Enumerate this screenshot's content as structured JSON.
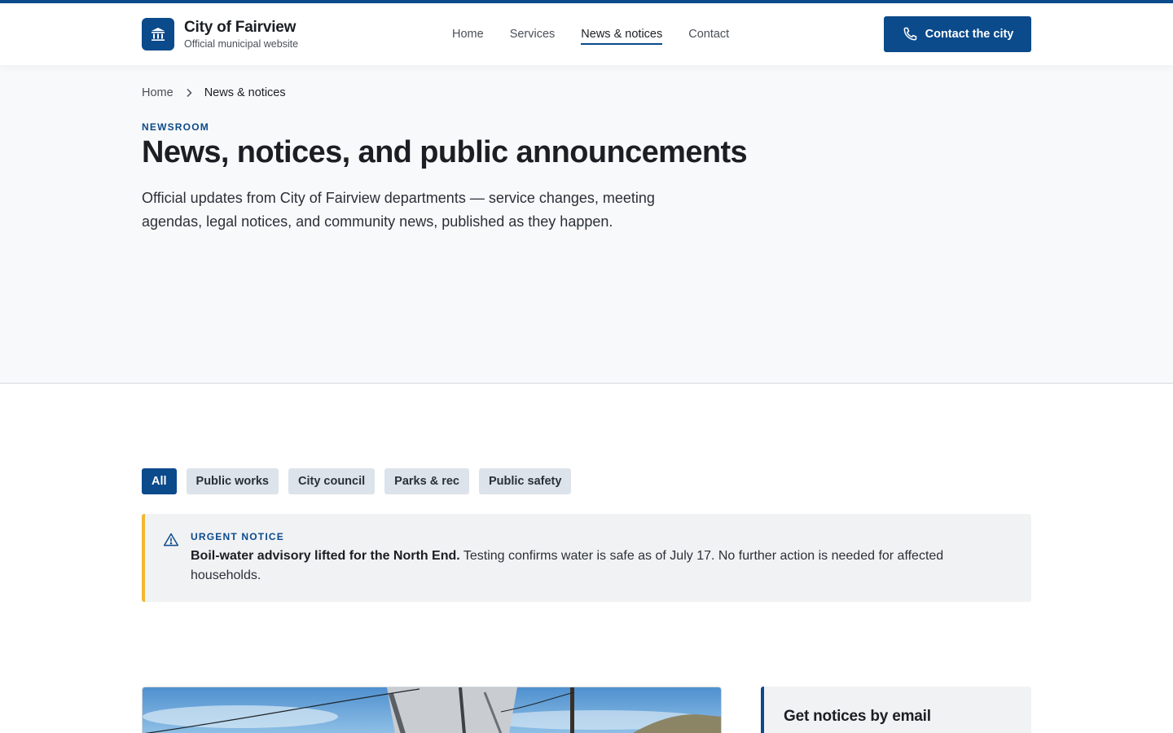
{
  "header": {
    "brand_name": "City of Fairview",
    "brand_tagline": "Official municipal website",
    "brand_icon": "city-hall-icon",
    "nav": [
      {
        "label": "Home",
        "active": false
      },
      {
        "label": "Services",
        "active": false
      },
      {
        "label": "News & notices",
        "active": true
      },
      {
        "label": "Contact",
        "active": false
      }
    ],
    "cta_label": "Contact the city",
    "cta_icon": "phone-icon"
  },
  "hero": {
    "breadcrumb": {
      "home": "Home",
      "current": "News & notices"
    },
    "eyebrow": "NEWSROOM",
    "title": "News, notices, and public announcements",
    "lede": "Official updates from City of Fairview departments — service changes, meeting agendas, legal notices, and community news, published as they happen."
  },
  "filters": {
    "chips": [
      {
        "label": "All",
        "active": true
      },
      {
        "label": "Public works",
        "active": false
      },
      {
        "label": "City council",
        "active": false
      },
      {
        "label": "Parks & rec",
        "active": false
      },
      {
        "label": "Public safety",
        "active": false
      }
    ]
  },
  "alert": {
    "label": "URGENT NOTICE",
    "headline": "Boil-water advisory lifted for the North End.",
    "body": "Testing confirms water is safe as of July 17. No further action is needed for affected households.",
    "icon": "warning-triangle-icon"
  },
  "subscribe": {
    "title": "Get notices by email"
  },
  "colors": {
    "brand": "#0b4a8b",
    "alert_accent": "#f2b632",
    "chip_bg": "#dde3ea",
    "surface": "#f0f2f4"
  }
}
